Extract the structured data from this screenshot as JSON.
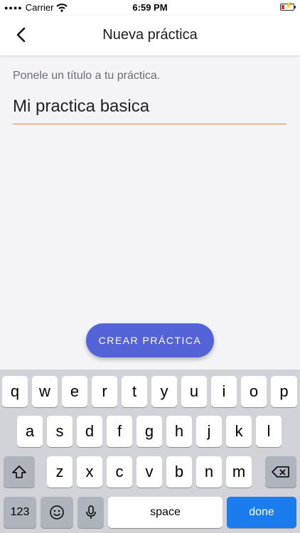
{
  "status_bar": {
    "carrier": "Carrier",
    "time": "6:59 PM"
  },
  "header": {
    "title": "Nueva práctica"
  },
  "form": {
    "label": "Ponele un título a tu práctica.",
    "title_value": "Mi practica basica"
  },
  "actions": {
    "create_label": "CREAR PRÁCTICA"
  },
  "keyboard": {
    "row1": [
      "q",
      "w",
      "e",
      "r",
      "t",
      "y",
      "u",
      "i",
      "o",
      "p"
    ],
    "row2": [
      "a",
      "s",
      "d",
      "f",
      "g",
      "h",
      "j",
      "k",
      "l"
    ],
    "row3": [
      "z",
      "x",
      "c",
      "v",
      "b",
      "n",
      "m"
    ],
    "numbers_label": "123",
    "space_label": "space",
    "done_label": "done"
  },
  "colors": {
    "accent": "#5463d8",
    "underline": "#e8813e",
    "done": "#1b7cf0"
  }
}
